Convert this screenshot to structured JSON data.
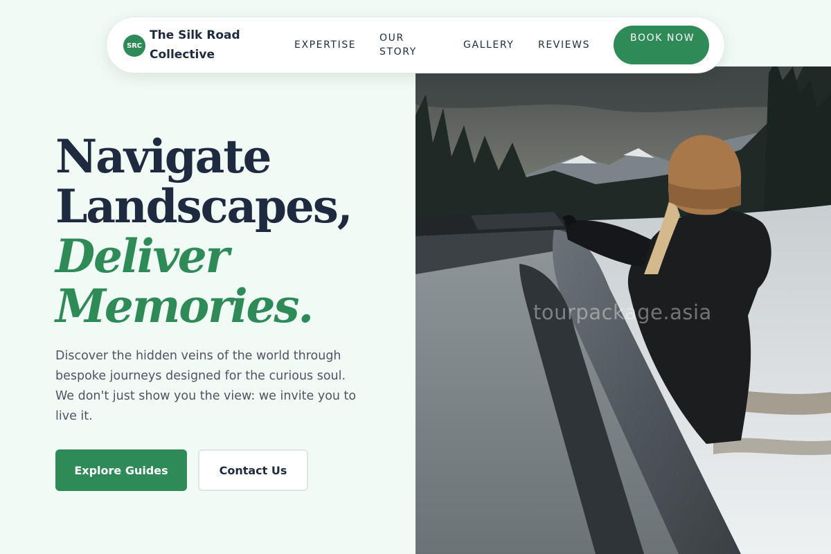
{
  "brand": {
    "badge": "SRC",
    "name": "The Silk Road Collective"
  },
  "nav": {
    "links": [
      {
        "label": "EXPERTISE"
      },
      {
        "label": "OUR STORY"
      },
      {
        "label": "GALLERY"
      },
      {
        "label": "REVIEWS"
      }
    ],
    "cta": "BOOK NOW"
  },
  "hero": {
    "headline_line1": "Navigate",
    "headline_line2": "Landscapes,",
    "headline_line3": "Deliver",
    "headline_line4": "Memories.",
    "lede": "Discover the hidden veins of the world through bespoke journeys designed for the curious soul. We don't just show you the view: we invite you to live it.",
    "primary_button": "Explore Guides",
    "secondary_button": "Contact Us",
    "image_watermark": "tourpackage.asia"
  },
  "colors": {
    "accent": "#2e8a57",
    "heading": "#1d2a40",
    "background": "#f1fbf6",
    "body_text": "#4b5563"
  }
}
